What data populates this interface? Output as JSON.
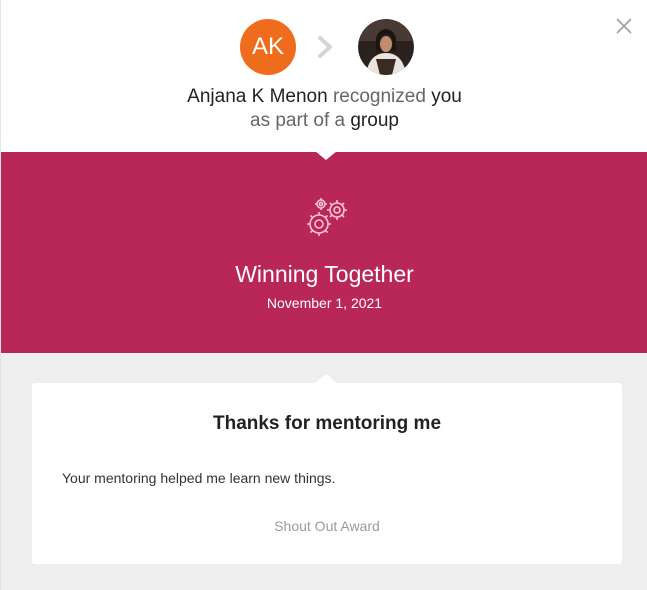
{
  "header": {
    "sender_initials": "AK",
    "sender_name": "Anjana K Menon",
    "text_recognized": "recognized",
    "text_you": "you",
    "text_as_part_of_a": "as part of a",
    "text_group": "group",
    "avatar_color": "#ee6c1b"
  },
  "award": {
    "icon": "gears-icon",
    "title": "Winning Together",
    "date": "November 1, 2021",
    "banner_color": "#b82758"
  },
  "card": {
    "title": "Thanks for mentoring me",
    "message": "Your mentoring helped me learn new things.",
    "award_type": "Shout Out Award"
  },
  "controls": {
    "close_icon": "close-icon",
    "chevron_icon": "chevron-right-icon"
  }
}
